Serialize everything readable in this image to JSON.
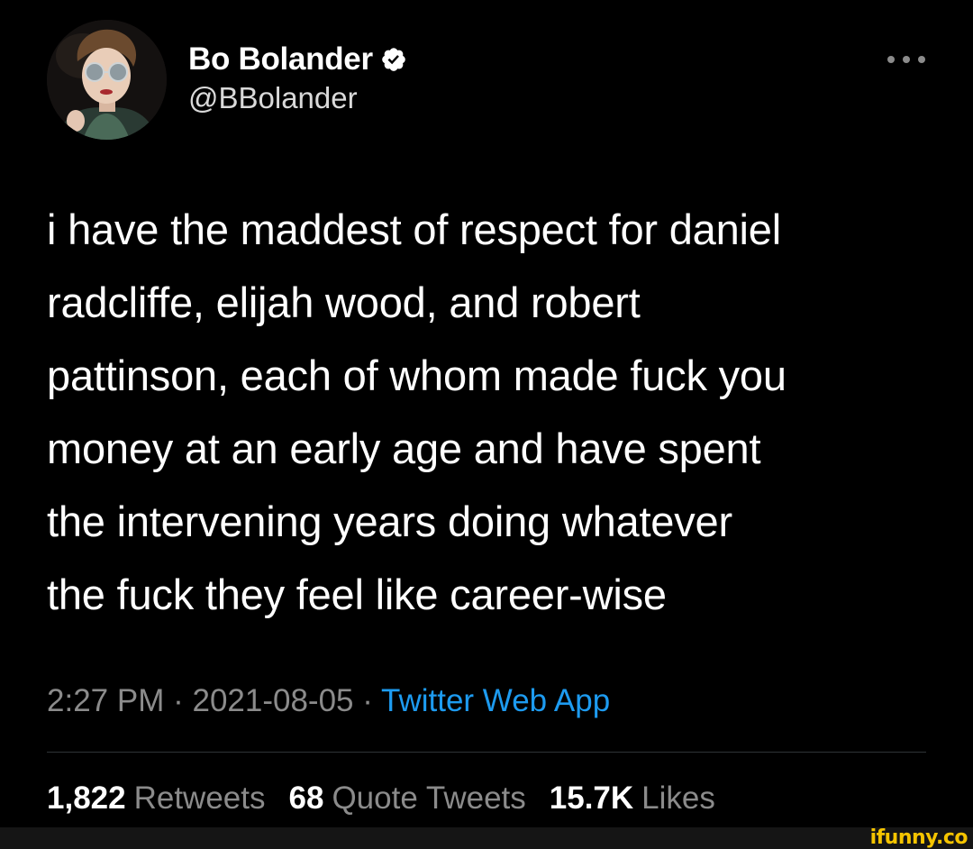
{
  "author": {
    "display_name": "Bo Bolander",
    "handle": "@BBolander",
    "verified": true
  },
  "icons": {
    "verified": "verified-badge-icon",
    "more": "more-options-icon"
  },
  "tweet": {
    "text": "i have the maddest of respect for daniel\nradcliffe, elijah wood, and robert\npattinson, each of whom made fuck you\nmoney at an early age and have spent\nthe intervening years doing whatever\nthe fuck they feel like career-wise"
  },
  "meta": {
    "time": "2:27 PM",
    "date": "2021-08-05",
    "separator": "·",
    "source": "Twitter Web App"
  },
  "stats": [
    {
      "count": "1,822",
      "label": "Retweets"
    },
    {
      "count": "68",
      "label": "Quote Tweets"
    },
    {
      "count": "15.7K",
      "label": "Likes"
    }
  ],
  "watermark": "ifunny.co",
  "colors": {
    "background": "#000000",
    "text": "#ffffff",
    "secondary": "#8b8b8b",
    "link": "#1d9bf0",
    "watermark": "#f5c400"
  }
}
